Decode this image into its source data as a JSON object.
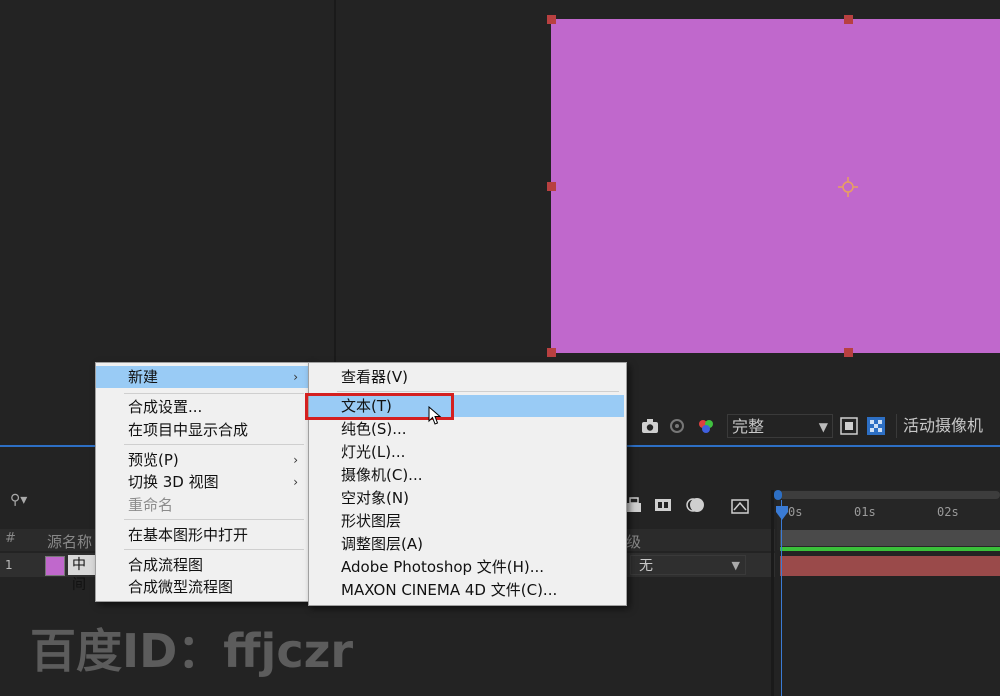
{
  "viewer": {
    "resolution_value": "完整",
    "camera_value": "活动摄像机",
    "solid_color": "#c068cc"
  },
  "timeline": {
    "columns": {
      "number": "#",
      "source_name": "源名称",
      "parent": "级"
    },
    "layer": {
      "number": "1",
      "name": "中间",
      "parent_value": "无",
      "label_color": "#c068cc"
    },
    "ruler_ticks": [
      "0s",
      "01s",
      "02s"
    ]
  },
  "context_menu": {
    "items": [
      {
        "label": "新建",
        "has_submenu": true,
        "highlighted": true
      },
      {
        "label": "合成设置..."
      },
      {
        "label": "在项目中显示合成"
      },
      {
        "label": "预览(P)",
        "has_submenu": true
      },
      {
        "label": "切换 3D 视图",
        "has_submenu": true
      },
      {
        "label": "重命名",
        "disabled": true
      },
      {
        "label": "在基本图形中打开"
      },
      {
        "label": "合成流程图"
      },
      {
        "label": "合成微型流程图"
      }
    ]
  },
  "submenu": {
    "items": [
      {
        "label": "查看器(V)"
      },
      {
        "label": "文本(T)",
        "highlighted": true
      },
      {
        "label": "纯色(S)..."
      },
      {
        "label": "灯光(L)..."
      },
      {
        "label": "摄像机(C)..."
      },
      {
        "label": "空对象(N)"
      },
      {
        "label": "形状图层"
      },
      {
        "label": "调整图层(A)"
      },
      {
        "label": "Adobe Photoshop 文件(H)..."
      },
      {
        "label": "MAXON CINEMA 4D 文件(C)..."
      }
    ]
  },
  "watermark": {
    "text": "百度ID：ffjczr"
  },
  "colors": {
    "accent_blue": "#2d6fc4",
    "highlight": "#99cbf5",
    "annotation_red": "#d42020"
  }
}
